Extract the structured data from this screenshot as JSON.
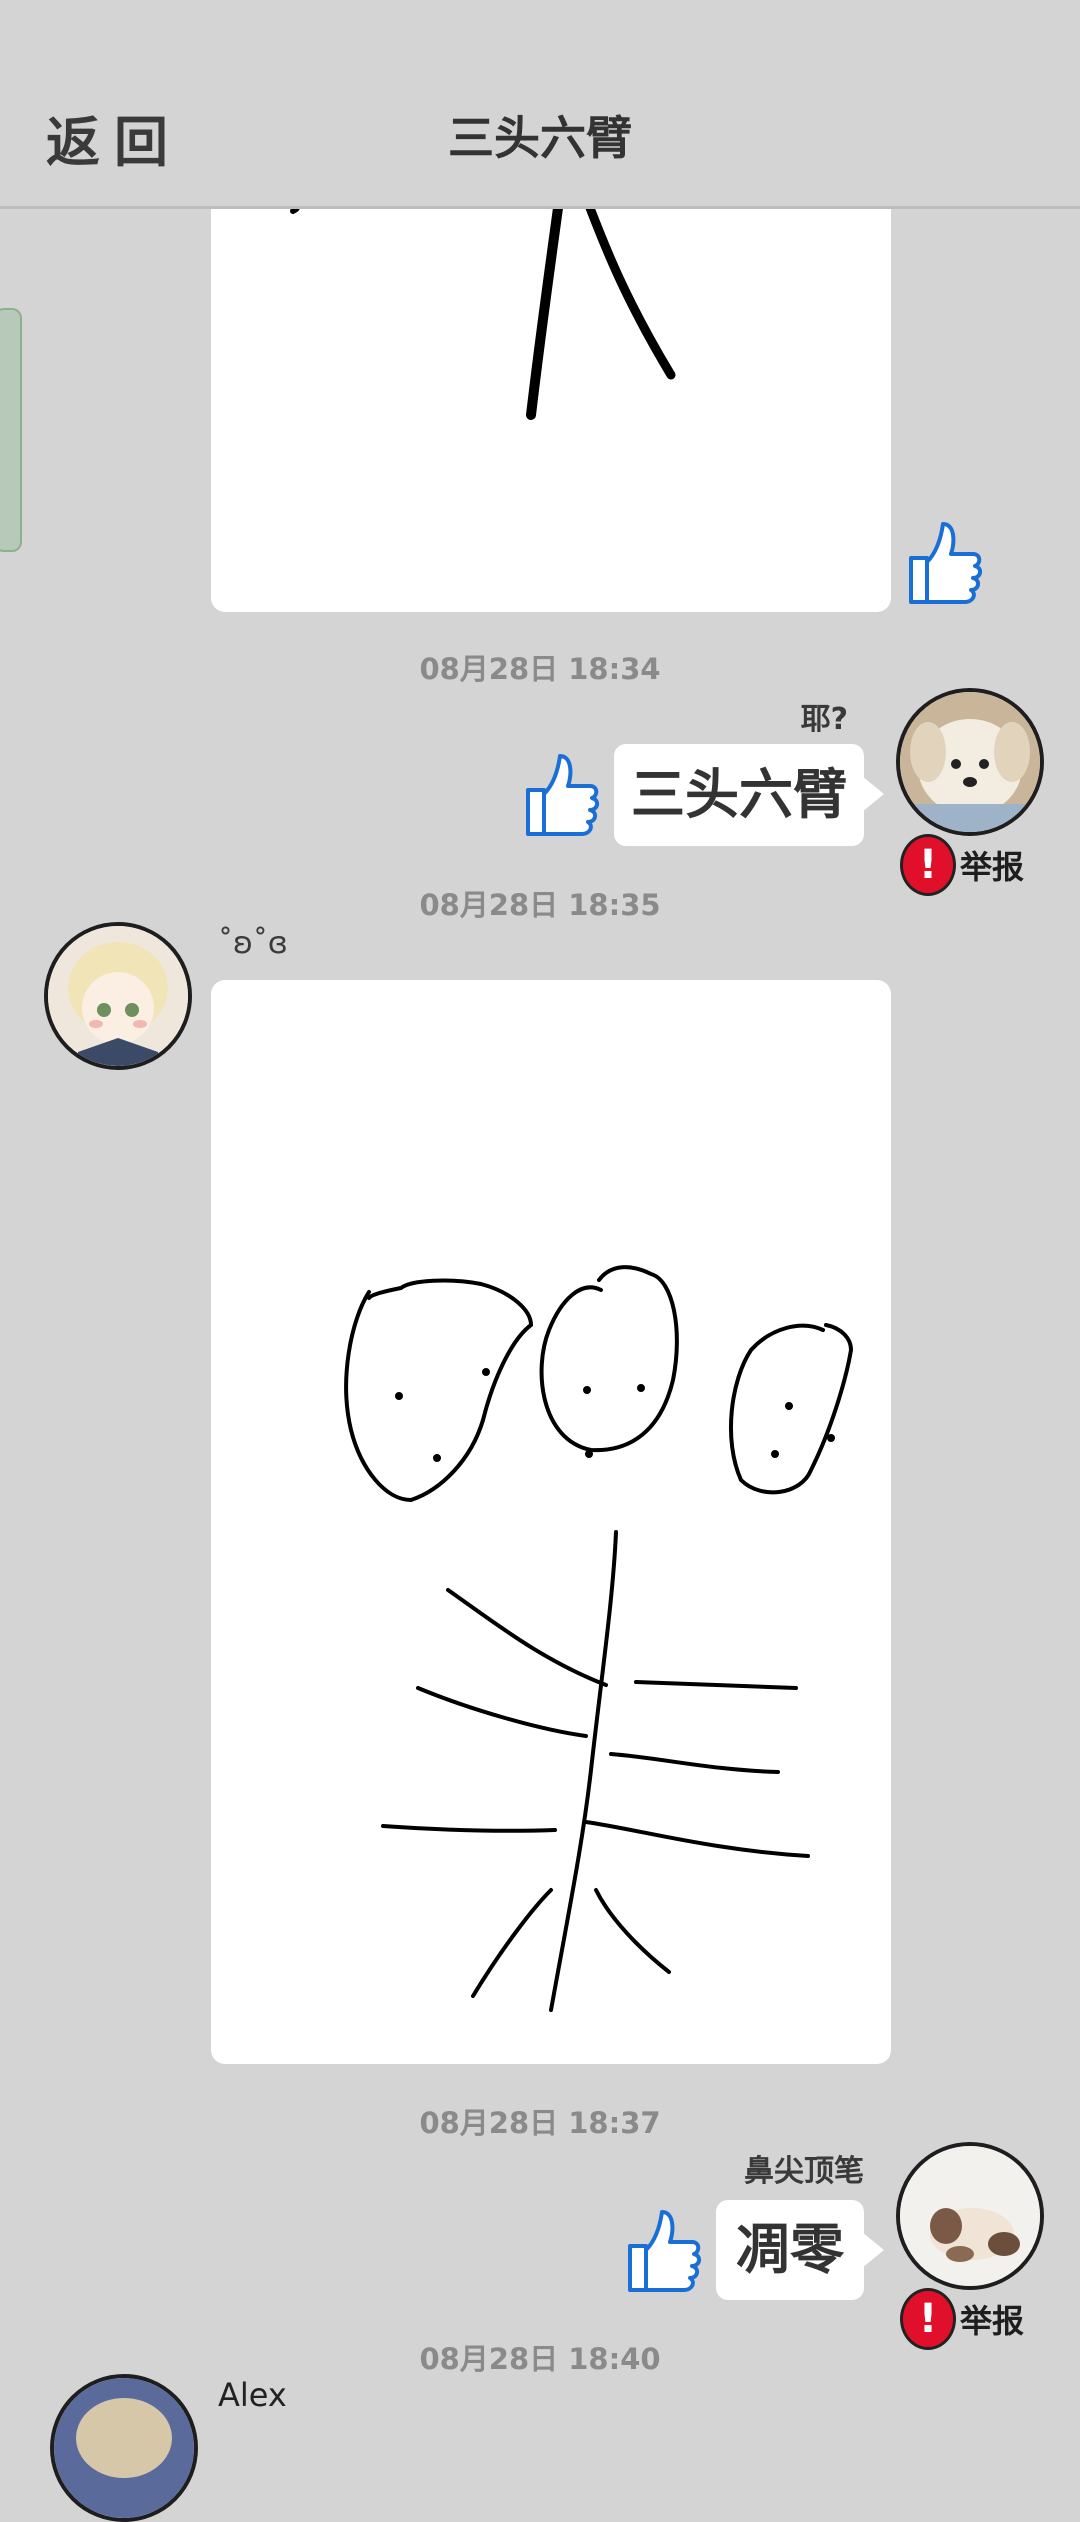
{
  "header": {
    "back_label": "返回",
    "title": "三头六臂"
  },
  "messages": [
    {
      "timestamp": "08月28日  18:34",
      "username": "耶?",
      "text": "三头六臂",
      "report_label": "举报"
    },
    {
      "timestamp": "08月28日  18:35",
      "username": "˚ʚ˚ɞ"
    },
    {
      "timestamp": "08月28日  18:37",
      "username": "鼻尖顶笔",
      "text": "凋零",
      "report_label": "举报"
    },
    {
      "timestamp": "08月28日  18:40",
      "username": "Alex"
    }
  ],
  "colors": {
    "background": "#d4d4d4",
    "like_blue": "#1a6fd6",
    "report_red": "#e0102a"
  }
}
